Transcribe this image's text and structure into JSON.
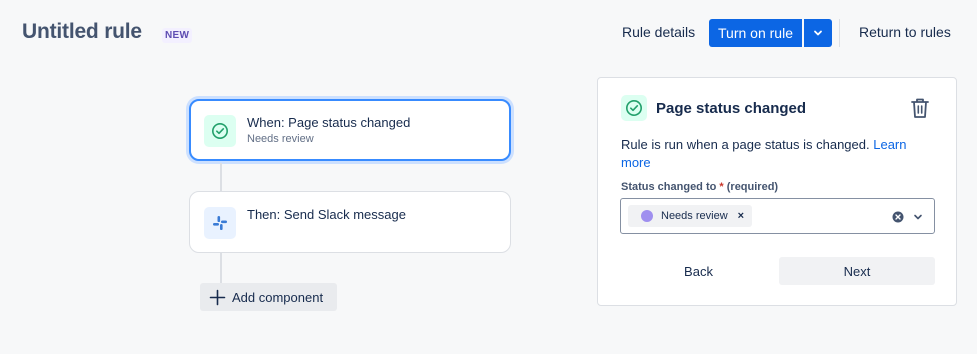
{
  "header": {
    "title": "Untitled rule",
    "badge": "NEW",
    "rule_details": "Rule details",
    "turn_on": "Turn on rule",
    "return": "Return to rules"
  },
  "flow": {
    "trigger": {
      "label": "When: Page status changed",
      "sub": "Needs review",
      "icon": "check-circle-icon"
    },
    "action": {
      "label": "Then: Send Slack message",
      "icon": "slack-icon"
    },
    "add_component": "Add component"
  },
  "panel": {
    "title": "Page status changed",
    "description": "Rule is run when a page status is changed.",
    "learn_more": "Learn more",
    "field_label": "Status changed to",
    "required_mark": "*",
    "required_text": "(required)",
    "selected": "Needs review",
    "chip_remove": "×",
    "back": "Back",
    "next": "Next"
  },
  "colors": {
    "primary": "#0c66e4",
    "status_dot": "#9f8fef",
    "success": "#22a06b"
  }
}
